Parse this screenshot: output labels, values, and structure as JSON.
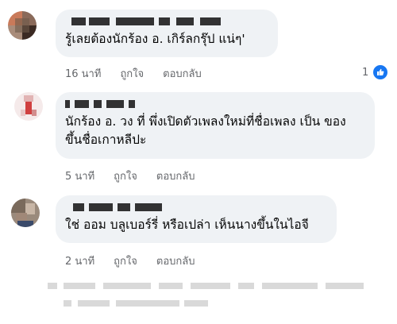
{
  "comments": [
    {
      "text": "รู้เลยต้องนักร้อง อ. เกิร์ลกรุ๊ป แน่ๆ'",
      "time": "16 นาที",
      "like_label": "ถูกใจ",
      "reply_label": "ตอบกลับ",
      "reaction_count": "1",
      "avatar_colors": [
        "#c97a5a",
        "#6e5a4a",
        "#a98c7a",
        "#3b2a23"
      ]
    },
    {
      "text": "นักร้อง อ. วง ที่ พึ่งเปิดตัวเพลงใหม่ที่ชื่อเพลง เป็น ของ\nขึ้นชื่อเกาหลีปะ",
      "time": "5 นาที",
      "like_label": "ถูกใจ",
      "reply_label": "ตอบกลับ",
      "avatar_colors": [
        "#e8c8c8",
        "#d04040",
        "#f2e0e0",
        "#b03030"
      ]
    },
    {
      "text": "ใช่ ออม บลูเบอร์รี่ หรือเปล่า เห็นนางขึ้นในไอจี",
      "time": "2 นาที",
      "like_label": "ถูกใจ",
      "reply_label": "ตอบกลับ",
      "avatar_colors": [
        "#7a6a5c",
        "#c8b6a6",
        "#3a4a6a",
        "#a08878"
      ]
    }
  ],
  "colors": {
    "bubble": "#eff2f5",
    "meta_text": "#65676b",
    "like_badge": "#1877f2"
  }
}
